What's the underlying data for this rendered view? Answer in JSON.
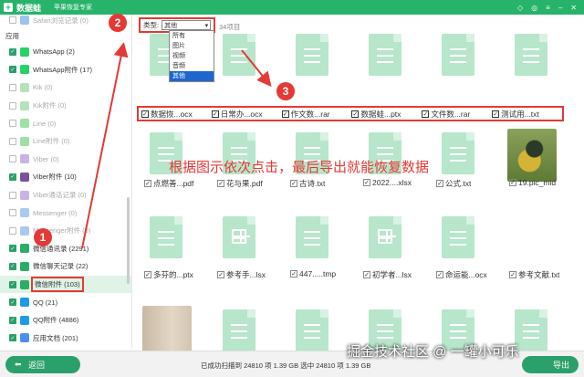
{
  "header": {
    "app_name": "数据蛙",
    "subtitle": "苹果恢复专家"
  },
  "sidebar": {
    "top_item": {
      "label": "Safari浏览记录 (0)"
    },
    "section_label": "应用",
    "items": [
      {
        "label": "WhatsApp (2)",
        "checked": true,
        "dim": false,
        "color": "#25d366"
      },
      {
        "label": "WhatsApp附件 (17)",
        "checked": true,
        "dim": false,
        "color": "#25d366"
      },
      {
        "label": "Kik (0)",
        "checked": false,
        "dim": true,
        "color": "#b5e3bd"
      },
      {
        "label": "Kik附件 (0)",
        "checked": false,
        "dim": true,
        "color": "#b5e3bd"
      },
      {
        "label": "Line (0)",
        "checked": false,
        "dim": true,
        "color": "#9ee0a5"
      },
      {
        "label": "Line附件 (0)",
        "checked": false,
        "dim": true,
        "color": "#9ee0a5"
      },
      {
        "label": "Viber (0)",
        "checked": false,
        "dim": true,
        "color": "#c7b3e8"
      },
      {
        "label": "Viber附件 (10)",
        "checked": true,
        "dim": false,
        "color": "#7b519d"
      },
      {
        "label": "Viber通话记录 (0)",
        "checked": false,
        "dim": true,
        "color": "#c7b3e8"
      },
      {
        "label": "Messenger (0)",
        "checked": false,
        "dim": true,
        "color": "#a9c9f2"
      },
      {
        "label": "Messenger附件 (0)",
        "checked": false,
        "dim": true,
        "color": "#a9c9f2"
      },
      {
        "label": "微信通讯录 (2291)",
        "checked": true,
        "dim": false,
        "color": "#2aae67"
      },
      {
        "label": "微信聊天记录 (22)",
        "checked": true,
        "dim": false,
        "color": "#2aae67"
      },
      {
        "label": "微信附件 (103)",
        "checked": true,
        "dim": false,
        "selected": true,
        "color": "#2aae67"
      },
      {
        "label": "QQ (21)",
        "checked": true,
        "dim": false,
        "color": "#1e9be6"
      },
      {
        "label": "QQ附件 (4886)",
        "checked": true,
        "dim": false,
        "color": "#1e9be6"
      },
      {
        "label": "应用文档 (201)",
        "checked": true,
        "dim": false,
        "color": "#4c8cf5"
      }
    ]
  },
  "toolbar": {
    "filter_label": "类型:",
    "filter_value": "其他",
    "count_text": "34项目"
  },
  "dropdown": {
    "options": [
      "所有",
      "图片",
      "视频",
      "音频",
      "其他"
    ],
    "active_index": 4
  },
  "annotations": {
    "step1": "1",
    "step2": "2",
    "step3": "3",
    "instruction": "根据图示依次点击，最后导出就能恢复数据"
  },
  "highlighted_files": [
    "数据恢...ocx",
    "日常办...ocx",
    "作文数...rar",
    "数据蛙...ptx",
    "文件数...rar",
    "测试用...txt"
  ],
  "file_rows": [
    [
      "点燃善...pdf",
      "花与果.pdf",
      "古诗.txt",
      "2022....xlsx",
      "公式.txt",
      "19.pic_mid"
    ],
    [
      "多芬的...ptx",
      "参考手...lsx",
      "447.....tmp",
      "初学者...lsx",
      "命运能...ocx",
      "参考文献.txt"
    ]
  ],
  "footer": {
    "back_label": "返回",
    "status": "已成功扫描到 24810 项 1.39 GB    选中 24810 项 1.39 GB",
    "export_label": "导出"
  },
  "watermark": "掘金技术社区 @ 一罐小可乐"
}
